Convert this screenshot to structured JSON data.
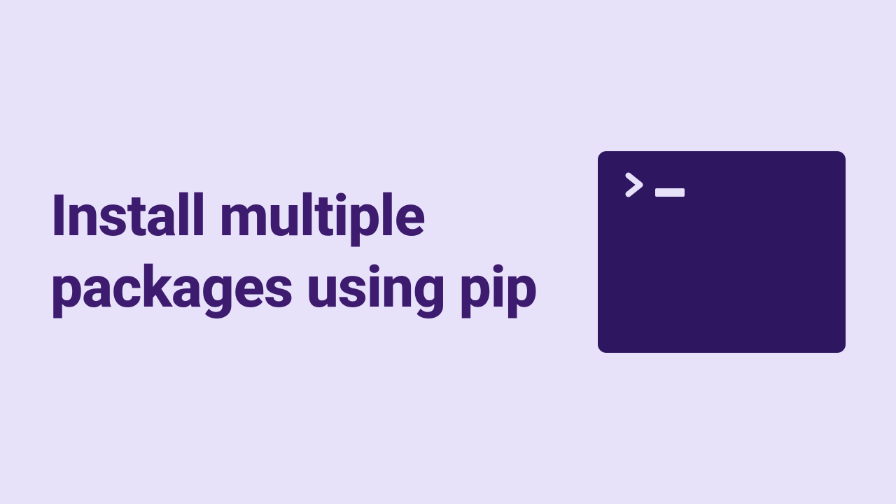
{
  "title": "Install multiple packages using pip",
  "colors": {
    "background": "#E8E1FA",
    "text": "#3D1B6E",
    "terminal": "#2E1760"
  },
  "icon": {
    "name": "terminal-icon",
    "prompt_symbol": ">",
    "underscore": "_"
  }
}
